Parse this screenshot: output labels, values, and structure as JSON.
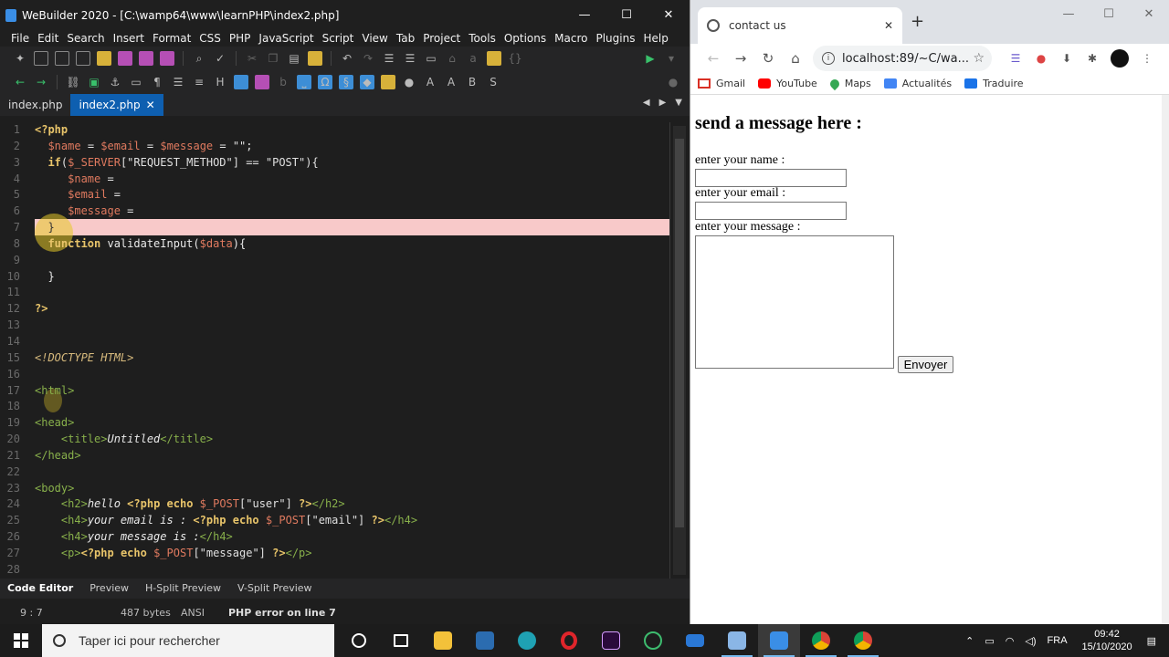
{
  "editor": {
    "title": "WeBuilder 2020 - [C:\\wamp64\\www\\learnPHP\\index2.php]",
    "window_buttons": [
      "—",
      "☐",
      "✕"
    ],
    "menu": [
      "File",
      "Edit",
      "Search",
      "Insert",
      "Format",
      "CSS",
      "PHP",
      "JavaScript",
      "Script",
      "View",
      "Tab",
      "Project",
      "Tools",
      "Options",
      "Macro",
      "Plugins",
      "Help"
    ],
    "tabs": [
      {
        "label": "index.php",
        "active": false
      },
      {
        "label": "index2.php",
        "active": true
      }
    ],
    "tab_close": "✕",
    "line_numbers": [
      "1",
      "2",
      "3",
      "4",
      "5",
      "6",
      "7",
      "8",
      "9",
      "10",
      "11",
      "12",
      "13",
      "14",
      "15",
      "16",
      "17",
      "18",
      "19",
      "20",
      "21",
      "22",
      "23",
      "24",
      "25",
      "26",
      "27",
      "28"
    ],
    "error_line": 7,
    "bottom_tabs": [
      "Code Editor",
      "Preview",
      "H-Split Preview",
      "V-Split Preview"
    ],
    "status": {
      "position": "9 : 7",
      "size": "487 bytes",
      "encoding": "ANSI",
      "message": "PHP error on line 7"
    }
  },
  "browser": {
    "tab_title": "contact us",
    "tab_close": "✕",
    "new_tab": "+",
    "window_buttons": [
      "—",
      "☐",
      "✕"
    ],
    "url": "localhost:89/~C/wa...",
    "bookmarks": [
      "Gmail",
      "YouTube",
      "Maps",
      "Actualités",
      "Traduire"
    ],
    "page": {
      "heading": "send a message here :",
      "name_label": "enter your name :",
      "email_label": "enter your email :",
      "message_label": "enter your message :",
      "submit_label": "Envoyer"
    }
  },
  "taskbar": {
    "search_placeholder": "Taper ici pour rechercher",
    "language": "FRA",
    "time": "09:42",
    "date": "15/10/2020"
  },
  "colors": {
    "editor_bg": "#1e1e1e",
    "active_tab": "#0e5fb0",
    "error_highlight": "#f8c9c9",
    "php_keyword": "#e8c46a",
    "php_variable": "#e07a5f",
    "taskbar_bg": "#1c1c1c"
  }
}
